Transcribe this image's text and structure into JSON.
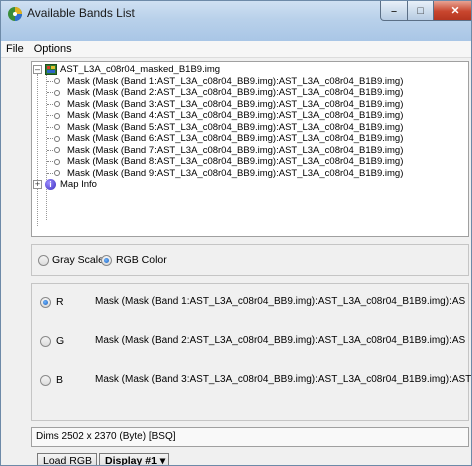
{
  "window": {
    "title": "Available Bands List"
  },
  "menu": [
    "File",
    "Options"
  ],
  "tree": {
    "root_label": "AST_L3A_c08r04_masked_B1B9.img",
    "bands": [
      "Mask (Mask (Band 1:AST_L3A_c08r04_BB9.img):AST_L3A_c08r04_B1B9.img)",
      "Mask (Mask (Band 2:AST_L3A_c08r04_BB9.img):AST_L3A_c08r04_B1B9.img)",
      "Mask (Mask (Band 3:AST_L3A_c08r04_BB9.img):AST_L3A_c08r04_B1B9.img)",
      "Mask (Mask (Band 4:AST_L3A_c08r04_BB9.img):AST_L3A_c08r04_B1B9.img)",
      "Mask (Mask (Band 5:AST_L3A_c08r04_BB9.img):AST_L3A_c08r04_B1B9.img)",
      "Mask (Mask (Band 6:AST_L3A_c08r04_BB9.img):AST_L3A_c08r04_B1B9.img)",
      "Mask (Mask (Band 7:AST_L3A_c08r04_BB9.img):AST_L3A_c08r04_B1B9.img)",
      "Mask (Mask (Band 8:AST_L3A_c08r04_BB9.img):AST_L3A_c08r04_B1B9.img)",
      "Mask (Mask (Band 9:AST_L3A_c08r04_BB9.img):AST_L3A_c08r04_B1B9.img)"
    ],
    "map_info_label": "Map Info"
  },
  "color_mode": {
    "gray_label": "Gray Scale",
    "rgb_label": "RGB Color",
    "selected": "RGB Color"
  },
  "rgb": {
    "r_label": "R",
    "g_label": "G",
    "b_label": "B",
    "selected_channel": "R",
    "r_band": "Mask (Mask (Band 1:AST_L3A_c08r04_BB9.img):AST_L3A_c08r04_B1B9.img):AS",
    "g_band": "Mask (Mask (Band 2:AST_L3A_c08r04_BB9.img):AST_L3A_c08r04_B1B9.img):AS",
    "b_band": "Mask (Mask (Band 3:AST_L3A_c08r04_BB9.img):AST_L3A_c08r04_B1B9.img):AST"
  },
  "dims": "Dims 2502 x 2370 (Byte) [BSQ]",
  "buttons": {
    "load": "Load RGB",
    "display": "Display #1 ▾"
  },
  "icons": {
    "app": "color-wheel-icon",
    "file": "raster-file-icon",
    "band": "band-node-icon",
    "info": "map-info-icon",
    "minimize": "minimize-icon",
    "maximize": "maximize-icon",
    "close": "close-icon"
  },
  "colors": {
    "title_bar": "#b9d1ea",
    "close_button": "#c8462e",
    "radio_checked": "#1b5fb8"
  }
}
